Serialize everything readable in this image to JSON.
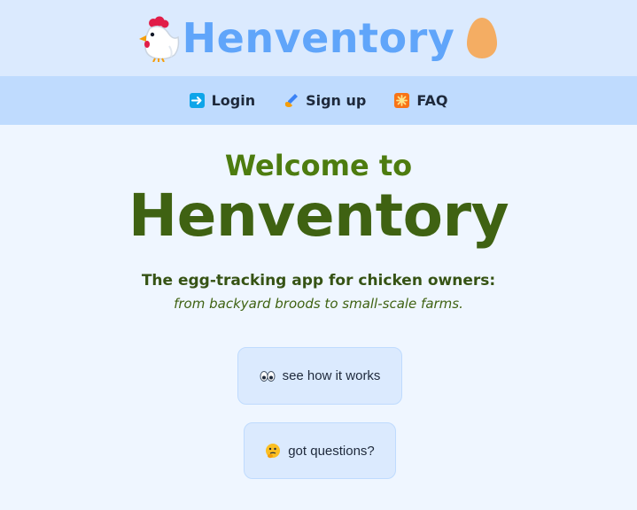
{
  "header": {
    "brand": "Henventory",
    "chicken_icon": "chicken-icon",
    "egg_icon": "egg-icon"
  },
  "nav": {
    "items": [
      {
        "label": "Login",
        "icon": "right-arrow-icon"
      },
      {
        "label": "Sign up",
        "icon": "writing-hand-icon"
      },
      {
        "label": "FAQ",
        "icon": "sparkle-icon"
      }
    ]
  },
  "hero": {
    "kicker": "Welcome to",
    "title": "Henventory",
    "tagline": "The egg-tracking app for chicken owners:",
    "tagline_sub": "from backyard broods to small-scale farms."
  },
  "actions": {
    "how_it_works": {
      "label": "see how it works",
      "icon": "eyes-icon"
    },
    "questions": {
      "label": "got questions?",
      "icon": "thinking-face-icon"
    }
  },
  "colors": {
    "header_bg": "#dbeafe",
    "nav_bg": "#bfdbfe",
    "page_bg": "#eff6ff",
    "brand": "#60a5fa",
    "hero_green": "#3f6212"
  }
}
